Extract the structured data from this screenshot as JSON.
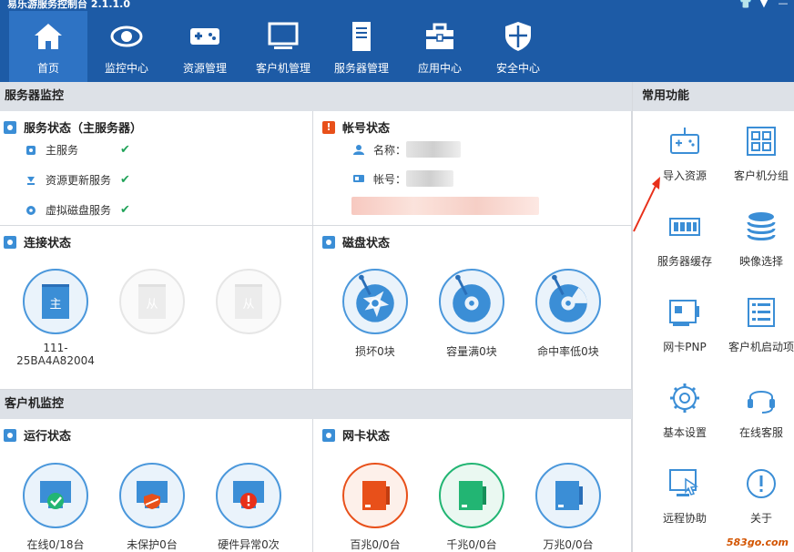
{
  "app": {
    "title": "易乐游服务控制台 2.1.1.0",
    "watermark": "583go.com"
  },
  "nav": [
    {
      "label": "首页",
      "icon": "home-icon",
      "active": true
    },
    {
      "label": "监控中心",
      "icon": "eye-icon"
    },
    {
      "label": "资源管理",
      "icon": "gamepad-icon"
    },
    {
      "label": "客户机管理",
      "icon": "monitor-icon"
    },
    {
      "label": "服务器管理",
      "icon": "server-icon"
    },
    {
      "label": "应用中心",
      "icon": "toolbox-icon"
    },
    {
      "label": "安全中心",
      "icon": "shield-icon"
    }
  ],
  "server_monitor": {
    "header": "服务器监控",
    "service_status": {
      "title": "服务状态（主服务器）",
      "items": [
        {
          "label": "主服务",
          "status": "✔"
        },
        {
          "label": "资源更新服务",
          "status": "✔"
        },
        {
          "label": "虚拟磁盘服务",
          "status": "✔"
        }
      ]
    },
    "account_status": {
      "title": "帐号状态",
      "name_label": "名称：",
      "account_label": "帐号："
    },
    "connection_status": {
      "title": "连接状态",
      "nodes": [
        {
          "glyph": "主",
          "caption": "111-25BA4A82004",
          "active": true
        },
        {
          "glyph": "从",
          "caption": "",
          "active": false
        },
        {
          "glyph": "从",
          "caption": "",
          "active": false
        }
      ]
    },
    "disk_status": {
      "title": "磁盘状态",
      "items": [
        {
          "label": "损坏0块"
        },
        {
          "label": "容量满0块"
        },
        {
          "label": "命中率低0块"
        }
      ]
    }
  },
  "client_monitor": {
    "header": "客户机监控",
    "run_status": {
      "title": "运行状态",
      "items": [
        {
          "label": "在线0/18台"
        },
        {
          "label": "未保护0台"
        },
        {
          "label": "硬件异常0次"
        }
      ]
    },
    "nic_status": {
      "title": "网卡状态",
      "items": [
        {
          "label": "百兆0/0台",
          "color": "#e8501a"
        },
        {
          "label": "千兆0/0台",
          "color": "#22b573"
        },
        {
          "label": "万兆0/0台",
          "color": "#3b8ed6"
        }
      ]
    }
  },
  "common_functions": {
    "header": "常用功能",
    "tools": [
      {
        "label": "导入资源",
        "icon": "gamepad-import-icon"
      },
      {
        "label": "客户机分组",
        "icon": "group-icon"
      },
      {
        "label": "服务器缓存",
        "icon": "memory-icon"
      },
      {
        "label": "映像选择",
        "icon": "disk-stack-icon"
      },
      {
        "label": "网卡PNP",
        "icon": "nic-card-icon"
      },
      {
        "label": "客户机启动项",
        "icon": "list-icon"
      },
      {
        "label": "基本设置",
        "icon": "gear-icon"
      },
      {
        "label": "在线客服",
        "icon": "headset-icon"
      },
      {
        "label": "远程协助",
        "icon": "remote-icon"
      },
      {
        "label": "关于",
        "icon": "info-icon"
      }
    ]
  }
}
